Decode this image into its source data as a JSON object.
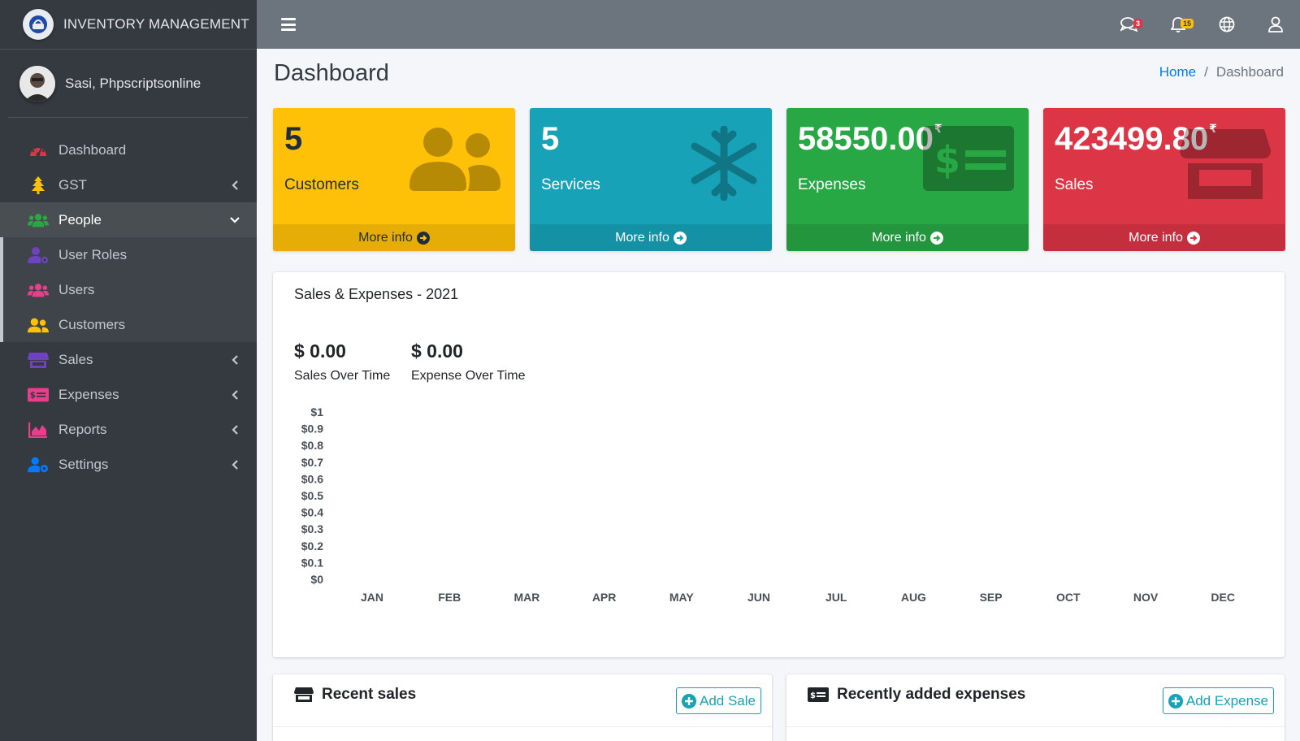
{
  "brand": {
    "title": "INVENTORY MANAGEMENT"
  },
  "user": {
    "name": "Sasi, Phpscriptsonline"
  },
  "sidebar": {
    "items": [
      {
        "label": "Dashboard",
        "icon": "tachometer-icon",
        "color": "#dc3545"
      },
      {
        "label": "GST",
        "icon": "tree-icon",
        "color": "#ffc107"
      },
      {
        "label": "People",
        "icon": "users-icon",
        "color": "#28a745"
      },
      {
        "label": "Sales",
        "icon": "store-icon",
        "color": "#6f42c1"
      },
      {
        "label": "Expenses",
        "icon": "money-bill-icon",
        "color": "#e83e8c"
      },
      {
        "label": "Reports",
        "icon": "area-chart-icon",
        "color": "#e83e8c"
      },
      {
        "label": "Settings",
        "icon": "users-cog-icon",
        "color": "#007bff"
      }
    ],
    "people_subitems": [
      {
        "label": "User Roles",
        "icon": "user-roles-icon",
        "color": "#6f42c1"
      },
      {
        "label": "Users",
        "icon": "users-icon",
        "color": "#e83e8c"
      },
      {
        "label": "Customers",
        "icon": "user-friends-icon",
        "color": "#ffc107"
      }
    ]
  },
  "topbar": {
    "messages_badge": "3",
    "notifications_badge": "15"
  },
  "page": {
    "title": "Dashboard",
    "breadcrumb": {
      "home": "Home",
      "separator": "/",
      "current": "Dashboard"
    }
  },
  "boxes": [
    {
      "value": "5",
      "currency": "",
      "caption": "Customers",
      "more": "More info",
      "color": "#ffc107"
    },
    {
      "value": "5",
      "currency": "",
      "caption": "Services",
      "more": "More info",
      "color": "#17a2b8"
    },
    {
      "value": "58550.00",
      "currency": "₹",
      "caption": "Expenses",
      "more": "More info",
      "color": "#28a745"
    },
    {
      "value": "423499.80",
      "currency": "₹",
      "caption": "Sales",
      "more": "More info",
      "color": "#dc3545"
    }
  ],
  "chart_card": {
    "title": "Sales & Expenses - 2021",
    "sales_amount": "$ 0.00",
    "sales_label": "Sales Over Time",
    "expense_amount": "$ 0.00",
    "expense_label": "Expense Over Time"
  },
  "chart_data": {
    "type": "line",
    "categories": [
      "JAN",
      "FEB",
      "MAR",
      "APR",
      "MAY",
      "JUN",
      "JUL",
      "AUG",
      "SEP",
      "OCT",
      "NOV",
      "DEC"
    ],
    "y_tick_labels": [
      "$1",
      "$0.9",
      "$0.8",
      "$0.7",
      "$0.6",
      "$0.5",
      "$0.4",
      "$0.3",
      "$0.2",
      "$0.1",
      "$0"
    ],
    "ylim": [
      0,
      1
    ],
    "series": [],
    "grid": false,
    "title": "",
    "xlabel": "",
    "ylabel": ""
  },
  "recent_sales": {
    "title": "Recent sales",
    "button": "Add Sale"
  },
  "recent_expenses": {
    "title": "Recently added expenses",
    "button": "Add Expense"
  }
}
